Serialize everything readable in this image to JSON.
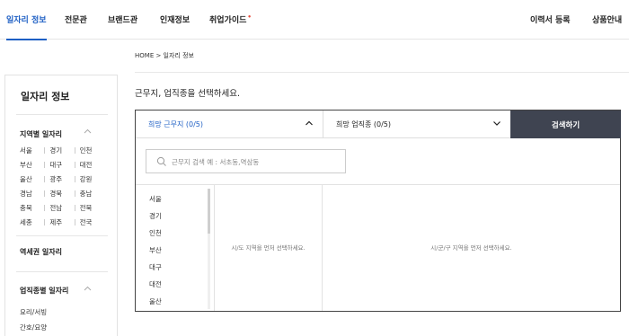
{
  "nav": {
    "items": [
      "일자리 정보",
      "전문관",
      "브랜드관",
      "인재정보",
      "취업가이드"
    ],
    "badge": "•",
    "right": [
      "이력서 등록",
      "상품안내"
    ]
  },
  "breadcrumb": "HOME > 일자리 정보",
  "sidebar": {
    "title": "일자리 정보",
    "region_heading": "지역별 일자리",
    "regions": [
      [
        "서울",
        "경기",
        "인천"
      ],
      [
        "부산",
        "대구",
        "대전"
      ],
      [
        "울산",
        "광주",
        "강원"
      ],
      [
        "경남",
        "경북",
        "충남"
      ],
      [
        "충북",
        "전남",
        "전북"
      ],
      [
        "세종",
        "제주",
        "전국"
      ]
    ],
    "station_heading": "역세권 일자리",
    "job_heading": "업직종별 일자리",
    "jobs": [
      "요리/서빙",
      "간호/요양"
    ]
  },
  "main": {
    "prompt": "근무지, 업직종을 선택하세요.",
    "tab_location": "희망 근무지 (0/5)",
    "tab_job": "희망 업직종 (0/5)",
    "search_button": "검색하기",
    "search_placeholder": "근무지 검색 예 : 서초동,역삼동",
    "cities": [
      "서울",
      "경기",
      "인천",
      "부산",
      "대구",
      "대전",
      "울산"
    ],
    "msg_district": "시/도 지역을 먼저 선택하세요.",
    "msg_dong": "시/군/구 지역을 먼저 선택하세요."
  },
  "colors": {
    "accent": "#1e5fc4",
    "button_bg": "#3f4451"
  }
}
